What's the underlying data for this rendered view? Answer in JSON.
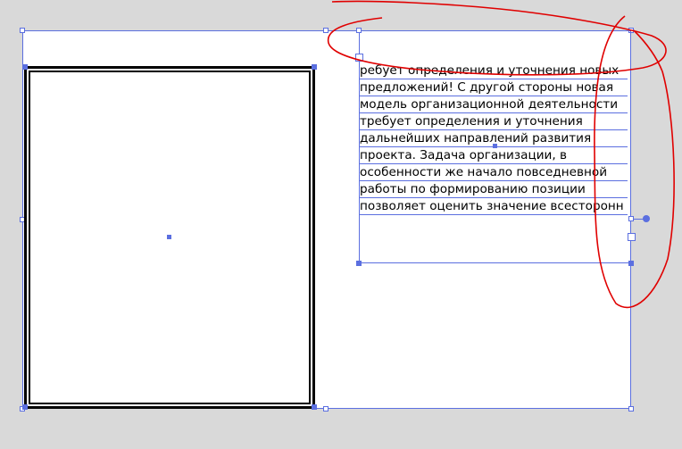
{
  "text_frame": {
    "lines": [
      "ребует определения и уточнения новых",
      "предложений! С другой стороны новая",
      "модель организационной деятельности",
      "требует определения и уточнения",
      "дальнейших направлений развития",
      "проекта. Задача организации, в",
      "особенности же начало повседневной",
      "работы по формированию позиции",
      "позволяет оценить значение всесторонн"
    ]
  },
  "colors": {
    "canvas": "#d9d9d9",
    "selection": "#5b6fe0",
    "annotation": "#e00000"
  }
}
